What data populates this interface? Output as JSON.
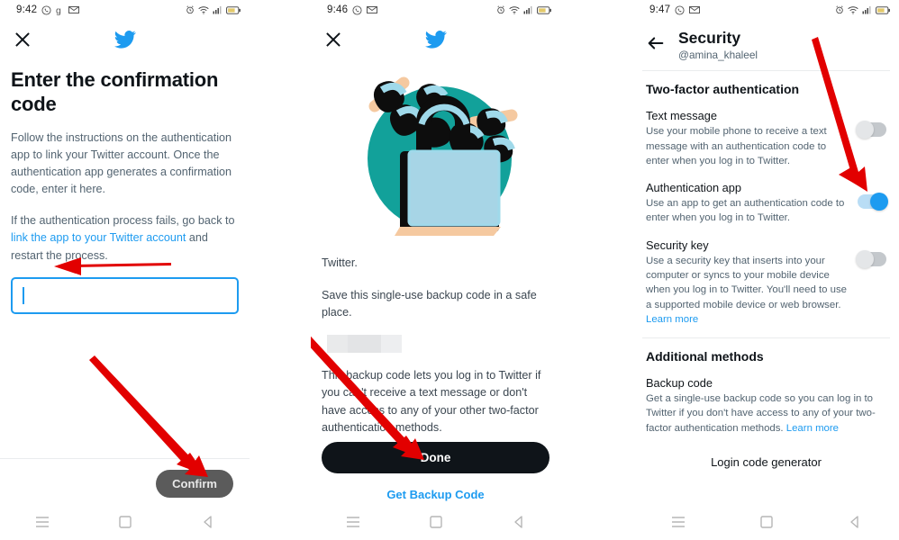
{
  "accent": {
    "twitter_blue": "#1d9bf0",
    "arrow_red": "#e20000",
    "teal": "#11998e",
    "dark": "#0f1419"
  },
  "panel1": {
    "status": {
      "time": "9:42",
      "icons": [
        "whatsapp-icon",
        "google-icon",
        "gmail-icon",
        "alarm-icon",
        "wifi-icon",
        "signal-icon",
        "battery-icon"
      ]
    },
    "appbar": {
      "close": "close-icon",
      "logo": "twitter-bird-icon"
    },
    "title": "Enter the confirmation code",
    "para1": "Follow the instructions on the authentication app to link your Twitter account. Once the authentication app generates a confirmation code, enter it here.",
    "para2_before": "If the authentication process fails, go back to ",
    "para2_link": "link the app to your Twitter account",
    "para2_after": " and restart the process.",
    "input": {
      "value": "",
      "placeholder": ""
    },
    "confirm_label": "Confirm",
    "nav": [
      "recents-icon",
      "home-icon",
      "back-icon"
    ]
  },
  "panel2": {
    "status": {
      "time": "9:46"
    },
    "appbar": {
      "close": "close-icon",
      "logo": "twitter-bird-icon"
    },
    "illustration": "padlock-chain-illustration",
    "para1": "Twitter.",
    "para2": "Save this single-use backup code in a safe place.",
    "backup_code_redacted": "",
    "para3": "This backup code lets you log in to Twitter if you can't receive a text message or don't have access to any of your other two-factor authentication methods.",
    "done_label": "Done",
    "get_backup_label": "Get Backup Code",
    "nav": [
      "recents-icon",
      "home-icon",
      "back-icon"
    ]
  },
  "panel3": {
    "status": {
      "time": "9:47"
    },
    "back": "back-arrow-icon",
    "title": "Security",
    "handle": "@amina_khaleel",
    "section1": "Two-factor authentication",
    "options": [
      {
        "name": "Text message",
        "desc": "Use your mobile phone to receive a text message with an authentication code to enter when you log in to Twitter.",
        "state": "off"
      },
      {
        "name": "Authentication app",
        "desc": "Use an app to get an authentication code to enter when you log in to Twitter.",
        "state": "on"
      },
      {
        "name": "Security key",
        "desc": "Use a security key that inserts into your computer or syncs to your mobile device when you log in to Twitter. You'll need to use a supported mobile device or web browser. ",
        "link": "Learn more",
        "state": "off"
      }
    ],
    "section2": "Additional methods",
    "backup": {
      "name": "Backup code",
      "desc": "Get a single-use backup code so you can log in to Twitter if you don't have access to any of your two-factor authentication methods. ",
      "link": "Learn more"
    },
    "login_code_generator": "Login code generator",
    "nav": [
      "recents-icon",
      "home-icon",
      "back-icon"
    ]
  }
}
